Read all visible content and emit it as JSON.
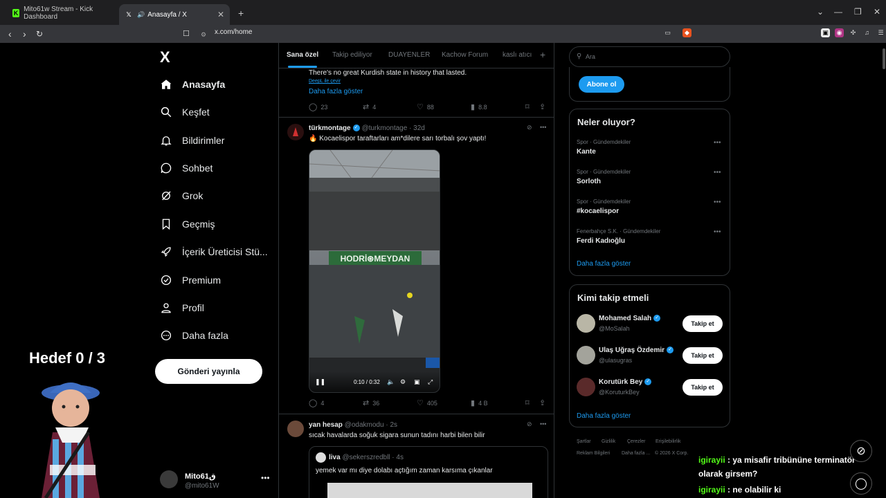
{
  "browser": {
    "tabs": [
      {
        "title": "Mito61w Stream - Kick Dashboard",
        "favicon": "kick-logo-icon"
      },
      {
        "title": "Anasayfa / X",
        "favicon": "x-logo-icon"
      }
    ],
    "new_tab": "+",
    "url": "x.com/home"
  },
  "sidebar": {
    "logo": "X",
    "items": [
      {
        "label": "Anasayfa",
        "icon": "home-icon"
      },
      {
        "label": "Keşfet",
        "icon": "search-icon"
      },
      {
        "label": "Bildirimler",
        "icon": "bell-icon"
      },
      {
        "label": "Sohbet",
        "icon": "chat-icon"
      },
      {
        "label": "Grok",
        "icon": "grok-icon"
      },
      {
        "label": "Geçmiş",
        "icon": "bookmark-icon"
      },
      {
        "label": "İçerik Üreticisi Stü...",
        "icon": "rocket-icon"
      },
      {
        "label": "Premium",
        "icon": "verified-icon"
      },
      {
        "label": "Profil",
        "icon": "person-icon"
      },
      {
        "label": "Daha fazla",
        "icon": "more-circle-icon"
      }
    ],
    "post_button": "Gönderi yayınla",
    "account": {
      "name": "Mito61ق",
      "handle": "@mito61W"
    }
  },
  "overlay": {
    "goal": "Hedef 0 / 3"
  },
  "feed": {
    "tabs": [
      "Sana özel",
      "Takip ediliyor",
      "DUAYENLER",
      "Kachow Forum",
      "kaslı atıcı"
    ],
    "post0": {
      "text": "There's no great Kurdish state in history that lasted.",
      "translate": "DeepL ile çevir",
      "show_more": "Daha fazla göster",
      "replies": "23",
      "reposts": "4",
      "likes": "88",
      "views": "8.8"
    },
    "post1": {
      "name": "türkmontage",
      "handle": "@turkmontage · 32d",
      "text": "🔥 Kocaelispor taraftarları am*dilere sarı torbalı şov yaptı!",
      "banner": "HODRİ⊛MEYDAN",
      "video_time": "0:10 / 0:32",
      "replies": "4",
      "reposts": "36",
      "likes": "405",
      "views": "4 B"
    },
    "post2": {
      "name": "yan hesap",
      "handle": "@odakmodu · 2s",
      "text": "sıcak havalarda soğuk sigara sunun tadını harbi bilen bilir",
      "quote": {
        "name": "liva",
        "handle": "@sekerszredbll · 4s",
        "text": "yemek var mı diye dolabı açtığım zaman karsıma çıkanlar"
      }
    }
  },
  "right": {
    "search_placeholder": "Ara",
    "subscribe_button": "Abone ol",
    "trends_title": "Neler oluyor?",
    "trends": [
      {
        "category": "Spor · Gündemdekiler",
        "name": "Kante"
      },
      {
        "category": "Spor · Gündemdekiler",
        "name": "Sorloth"
      },
      {
        "category": "Spor · Gündemdekiler",
        "name": "#kocaelispor"
      },
      {
        "category": "Fenerbahçe S.K. · Gündemdekiler",
        "name": "Ferdi Kadıoğlu"
      }
    ],
    "trends_more": "Daha fazla göster",
    "wtf_title": "Kimi takip etmeli",
    "wtf": [
      {
        "name": "Mohamed Salah",
        "handle": "@MoSalah",
        "button": "Takip et"
      },
      {
        "name": "Ulaş Uğraş Özdemir",
        "handle": "@ulasugras",
        "button": "Takip et"
      },
      {
        "name": "Korutürk Bey",
        "handle": "@KoruturkBey",
        "button": "Takip et"
      }
    ],
    "wtf_more": "Daha fazla göster",
    "footer": [
      "Şartlar",
      "Gizlilik",
      "Çerezler",
      "Erişilebilirlik",
      "Reklam Bilgileri",
      "Daha fazla ...",
      "© 2026 X Corp."
    ]
  },
  "chat": [
    {
      "user": "igirayii",
      "message": " : ya misafir tribününe terminatör olarak girsem?"
    },
    {
      "user": "igirayii",
      "message": " : ne olabilir ki"
    }
  ],
  "colors": {
    "accent": "#1d9bf0",
    "kick_green": "#53fc18",
    "background": "#000000"
  }
}
